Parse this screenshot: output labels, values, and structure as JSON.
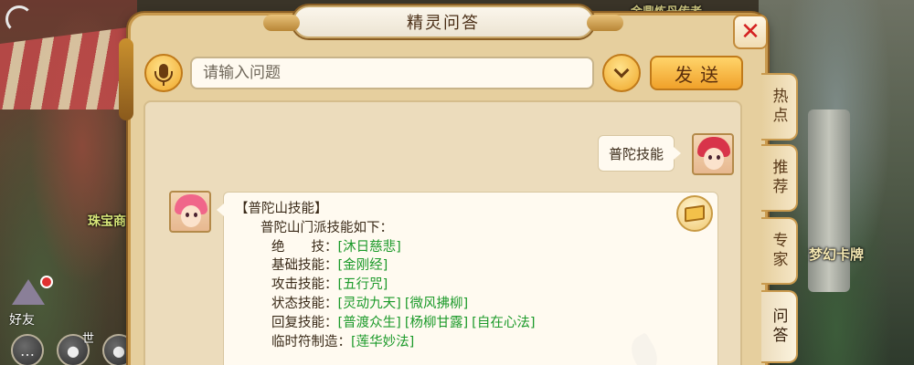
{
  "scene": {
    "npc_jeweler": "珠宝商",
    "npc_card": "梦幻卡牌",
    "npc_top": "金鼎炼丹传者",
    "friends_label": "好友",
    "world_label": "世"
  },
  "dialog": {
    "title": "精灵问答",
    "close_symbol": "✕",
    "search": {
      "placeholder": "请输入问题",
      "send_label": "发送"
    },
    "user_message": "普陀技能",
    "bot_reply": {
      "heading": "【普陀山技能】",
      "intro": "普陀山门派技能如下：",
      "rows": [
        {
          "label": "绝　　技：",
          "skills": [
            "[沐日慈悲]"
          ]
        },
        {
          "label": "基础技能：",
          "skills": [
            "[金刚经]"
          ]
        },
        {
          "label": "攻击技能：",
          "skills": [
            "[五行咒]"
          ]
        },
        {
          "label": "状态技能：",
          "skills": [
            "[灵动九天]",
            "[微风拂柳]"
          ]
        },
        {
          "label": "回复技能：",
          "skills": [
            "[普渡众生]",
            "[杨柳甘露]",
            "[自在心法]"
          ]
        },
        {
          "label": "临时符制造：",
          "skills": [
            "[莲华妙法]"
          ]
        }
      ]
    },
    "side_tabs": [
      {
        "label": "热点",
        "active": false
      },
      {
        "label": "推荐",
        "active": false
      },
      {
        "label": "专家",
        "active": false
      },
      {
        "label": "问答",
        "active": true
      }
    ]
  },
  "colors": {
    "skill_link": "#1c9a2a",
    "close_x": "#d42020",
    "panel_bg": "#e6cf9e"
  }
}
